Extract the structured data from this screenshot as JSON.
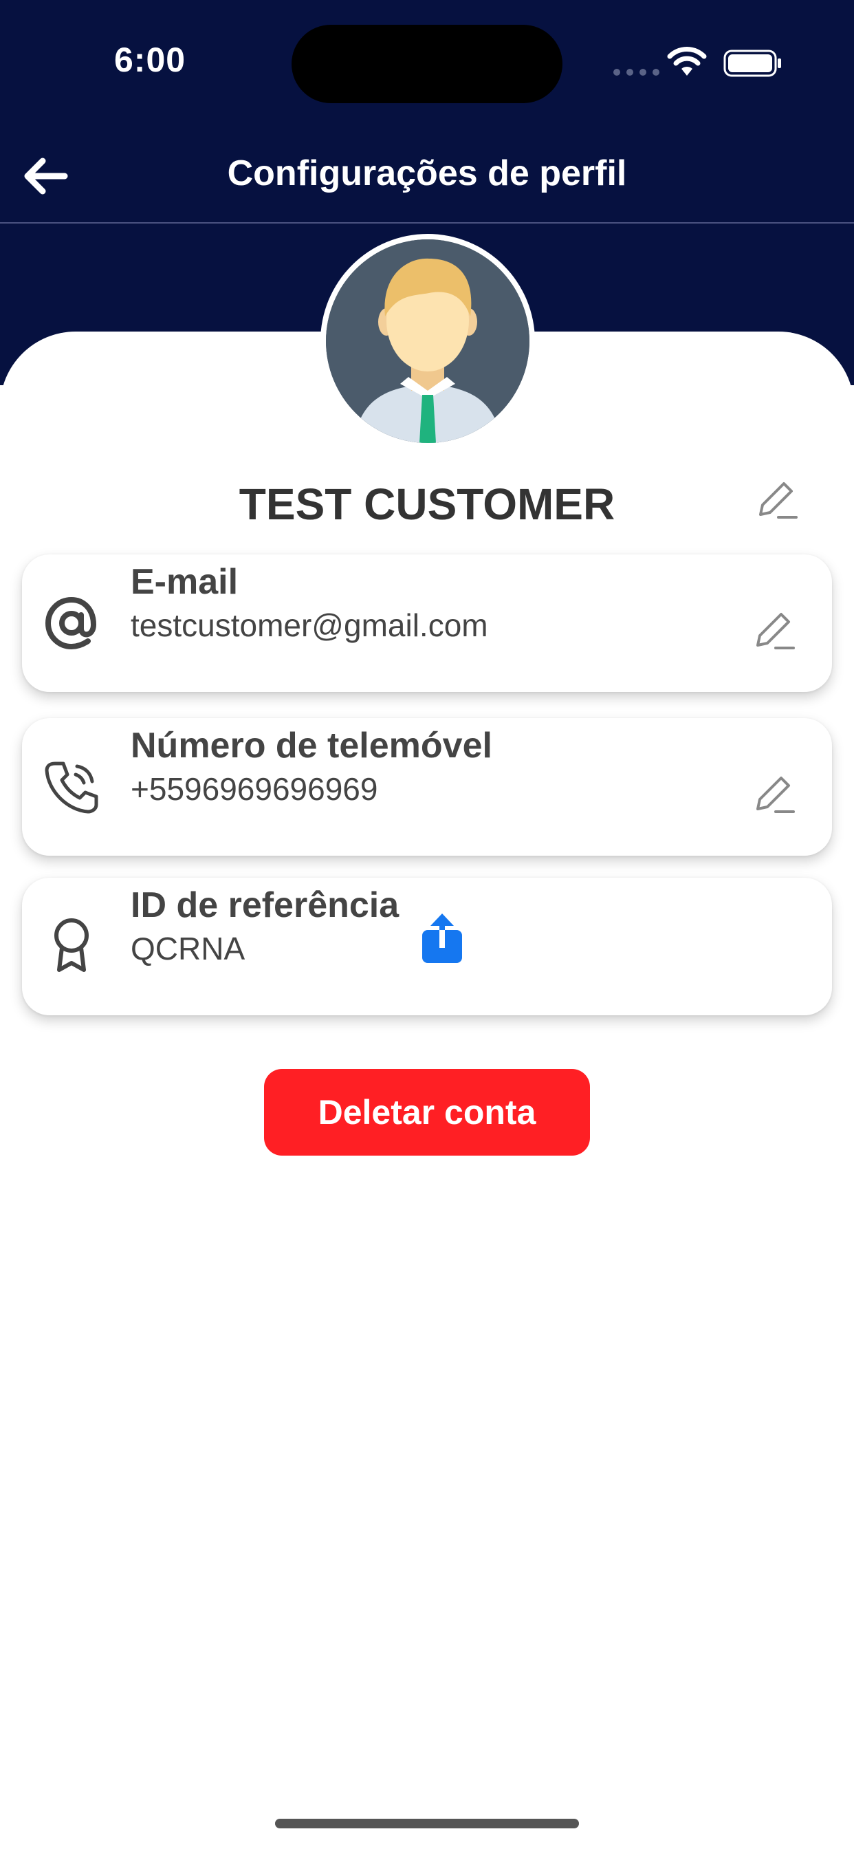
{
  "status_bar": {
    "time": "6:00"
  },
  "header": {
    "title": "Configurações de perfil",
    "back_icon": "arrow-left-icon",
    "background_color": "#061140"
  },
  "profile": {
    "name": "TEST CUSTOMER",
    "avatar_icon": "user-avatar"
  },
  "fields": [
    {
      "label": "E-mail",
      "value": "testcustomer@gmail.com",
      "icon": "at-sign-icon",
      "editable": true
    },
    {
      "label": "Número de telemóvel",
      "value": "+5596969696969",
      "icon": "phone-icon",
      "editable": true
    },
    {
      "label": "ID de referência",
      "value": "QCRNA",
      "icon": "award-icon",
      "editable": false,
      "action_icon": "share-icon"
    }
  ],
  "actions": {
    "delete_account": "Deletar conta",
    "delete_color": "#ff1f24"
  }
}
